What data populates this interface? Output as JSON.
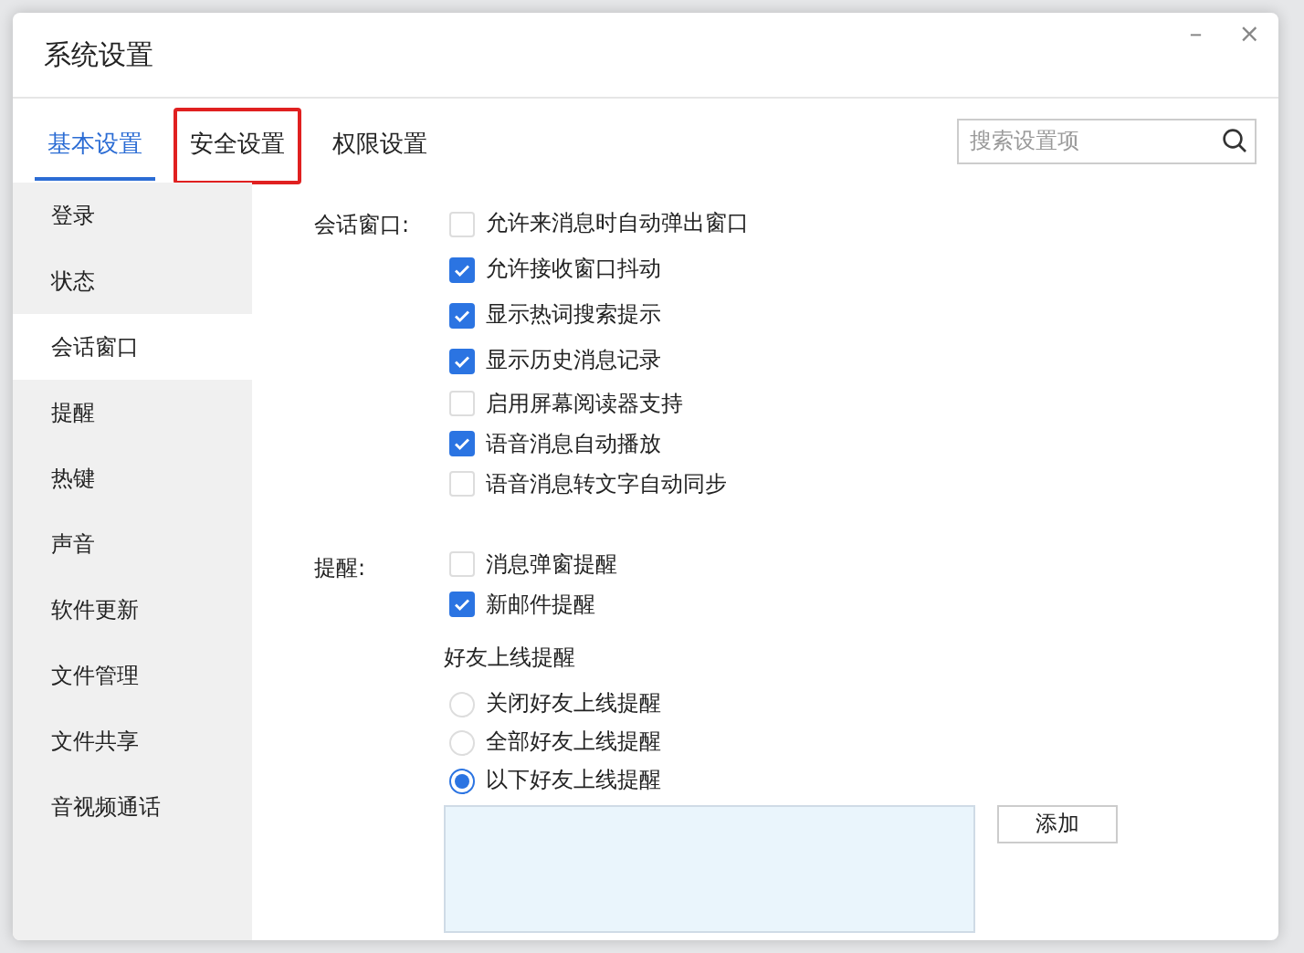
{
  "window": {
    "title": "系统设置",
    "controls": [
      "–",
      "×"
    ]
  },
  "tabs": [
    {
      "label": "基本设置",
      "selected": true,
      "highlighted": false
    },
    {
      "label": "安全设置",
      "selected": false,
      "highlighted": true
    },
    {
      "label": "权限设置",
      "selected": false,
      "highlighted": false
    }
  ],
  "search": {
    "placeholder": "搜索设置项"
  },
  "sidebar": {
    "items": [
      {
        "label": "登录",
        "selected": false
      },
      {
        "label": "状态",
        "selected": false
      },
      {
        "label": "会话窗口",
        "selected": true
      },
      {
        "label": "提醒",
        "selected": false
      },
      {
        "label": "热键",
        "selected": false
      },
      {
        "label": "声音",
        "selected": false
      },
      {
        "label": "软件更新",
        "selected": false
      },
      {
        "label": "文件管理",
        "selected": false
      },
      {
        "label": "文件共享",
        "selected": false
      },
      {
        "label": "音视频通话",
        "selected": false
      }
    ]
  },
  "sections": [
    {
      "label": "会话窗口:",
      "items": [
        {
          "kind": "checkbox",
          "label": "允许来消息时自动弹出窗口",
          "checked": false
        },
        {
          "kind": "checkbox",
          "label": "允许接收窗口抖动",
          "checked": true
        },
        {
          "kind": "checkbox",
          "label": "显示热词搜索提示",
          "checked": true
        },
        {
          "kind": "checkbox",
          "label": "显示历史消息记录",
          "checked": true
        },
        {
          "kind": "checkbox",
          "label": "启用屏幕阅读器支持",
          "checked": false
        },
        {
          "kind": "checkbox",
          "label": "语音消息自动播放",
          "checked": true
        },
        {
          "kind": "checkbox",
          "label": "语音消息转文字自动同步",
          "checked": false
        }
      ]
    },
    {
      "label": "提醒:",
      "items": [
        {
          "kind": "checkbox",
          "label": "消息弹窗提醒",
          "checked": false
        },
        {
          "kind": "checkbox",
          "label": "新邮件提醒",
          "checked": true
        },
        {
          "kind": "heading",
          "label": "好友上线提醒"
        },
        {
          "kind": "radio",
          "label": "关闭好友上线提醒",
          "selected": false
        },
        {
          "kind": "radio",
          "label": "全部好友上线提醒",
          "selected": false
        },
        {
          "kind": "radio",
          "label": "以下好友上线提醒",
          "selected": true
        },
        {
          "kind": "list",
          "button": "添加"
        }
      ]
    }
  ]
}
